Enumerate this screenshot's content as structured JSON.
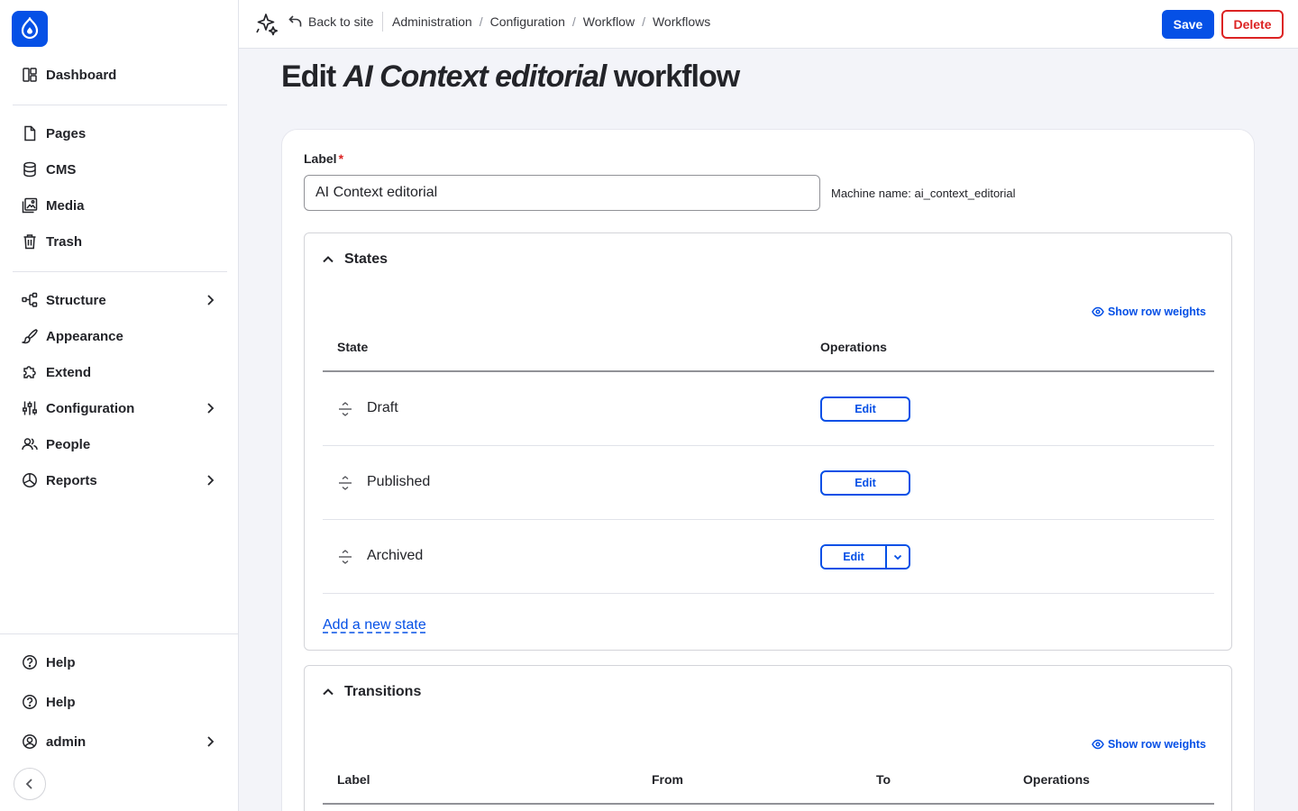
{
  "sidebar": {
    "primary": [
      {
        "label": "Dashboard",
        "icon": "dashboard-icon"
      }
    ],
    "content": [
      {
        "label": "Pages",
        "icon": "page-icon"
      },
      {
        "label": "CMS",
        "icon": "database-icon"
      },
      {
        "label": "Media",
        "icon": "image-icon"
      },
      {
        "label": "Trash",
        "icon": "trash-icon"
      }
    ],
    "admin": [
      {
        "label": "Structure",
        "icon": "structure-icon",
        "expandable": true
      },
      {
        "label": "Appearance",
        "icon": "brush-icon",
        "expandable": false
      },
      {
        "label": "Extend",
        "icon": "puzzle-icon",
        "expandable": false
      },
      {
        "label": "Configuration",
        "icon": "sliders-icon",
        "expandable": true
      },
      {
        "label": "People",
        "icon": "people-icon",
        "expandable": false
      },
      {
        "label": "Reports",
        "icon": "chart-pie-icon",
        "expandable": true
      }
    ],
    "footer": [
      {
        "label": "Help",
        "icon": "help-icon"
      },
      {
        "label": "Help",
        "icon": "help-icon"
      },
      {
        "label": "admin",
        "icon": "user-icon",
        "expandable": true
      }
    ]
  },
  "topbar": {
    "back_label": "Back to site",
    "breadcrumbs": [
      "Administration",
      "Configuration",
      "Workflow",
      "Workflows"
    ],
    "save_label": "Save",
    "delete_label": "Delete"
  },
  "page": {
    "title_prefix": "Edit ",
    "title_name": "AI Context editorial",
    "title_suffix": " workflow"
  },
  "form": {
    "label": "Label",
    "required_mark": "*",
    "label_value": "AI Context editorial",
    "machine_name": "Machine name: ai_context_editorial"
  },
  "states": {
    "heading": "States",
    "show_weights": "Show row weights",
    "columns": [
      "State",
      "Operations"
    ],
    "rows": [
      {
        "name": "Draft",
        "op": "Edit"
      },
      {
        "name": "Published",
        "op": "Edit"
      },
      {
        "name": "Archived",
        "op": "Edit"
      }
    ],
    "add_link": "Add a new state"
  },
  "transitions": {
    "heading": "Transitions",
    "show_weights": "Show row weights",
    "columns": [
      "Label",
      "From",
      "To",
      "Operations"
    ]
  },
  "colors": {
    "accent": "#0550e6",
    "danger": "#dc2323",
    "text": "#232429",
    "background": "#f3f4f9"
  }
}
